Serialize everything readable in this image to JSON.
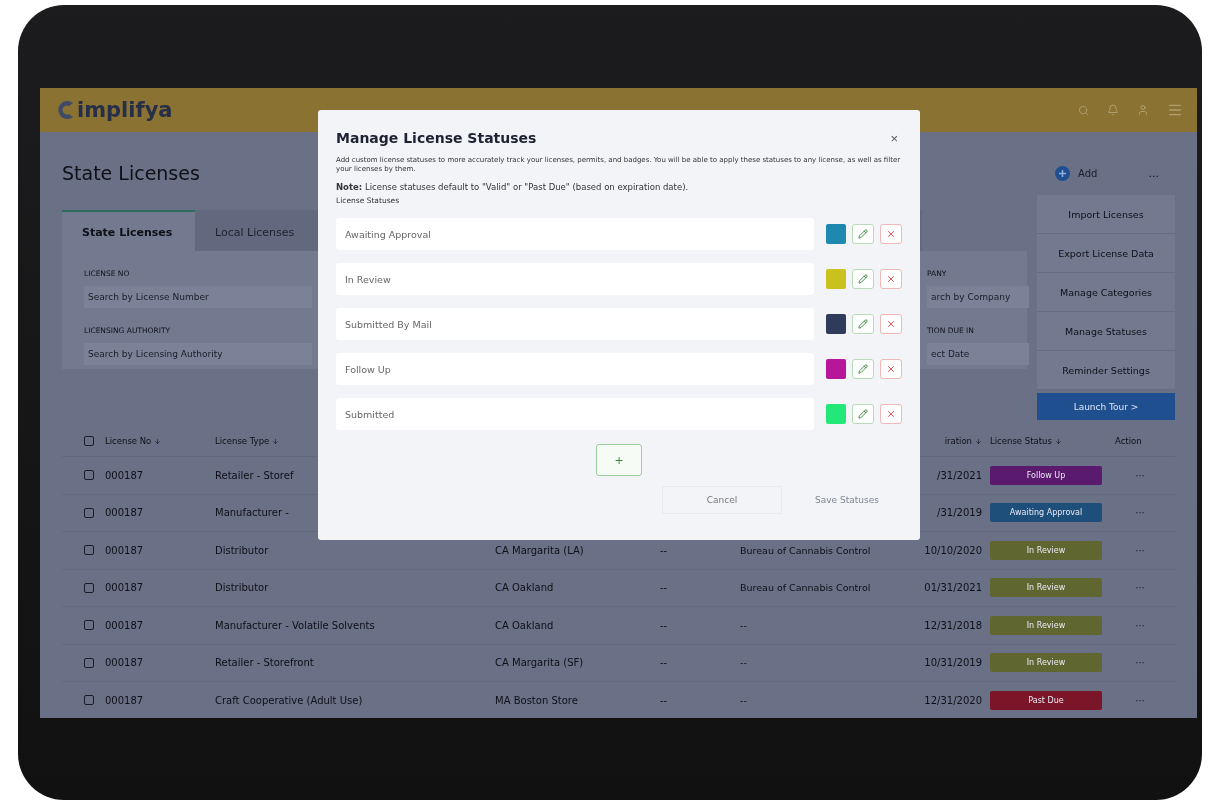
{
  "header": {
    "logo": "implifya"
  },
  "page": {
    "title": "State Licenses"
  },
  "tabs": [
    {
      "label": "State Licenses",
      "selected": true
    },
    {
      "label": "Local Licenses",
      "selected": false
    }
  ],
  "filters": [
    {
      "label": "LICENSE NO",
      "placeholder": "Search by License Number"
    },
    {
      "label": "LICENSING AUTHORITY",
      "placeholder": "Search by Licensing Authority"
    }
  ],
  "filters_right": [
    {
      "label": "PANY",
      "placeholder": "arch by Company"
    },
    {
      "label": "TION DUE IN",
      "placeholder": "ect Date"
    }
  ],
  "actions": {
    "add": "Add",
    "more": "...",
    "menu": [
      "Import Licenses",
      "Export License Data",
      "Manage Categories",
      "Manage Statuses",
      "Reminder Settings"
    ],
    "tour": "Launch Tour >"
  },
  "table": {
    "header_checked": false,
    "columns": [
      "License No",
      "License Type",
      "",
      "",
      "",
      "iration",
      "License Status",
      "Action"
    ],
    "rows": [
      {
        "checked": false,
        "number": "000187",
        "type": "Retailer - Storef",
        "location": "",
        "dash": "",
        "authority": "",
        "date": "/31/2021",
        "status": "Follow Up",
        "color": "#5a1a6e",
        "action": "···"
      },
      {
        "checked": false,
        "number": "000187",
        "type": "Manufacturer -",
        "location": "",
        "dash": "",
        "authority": "",
        "date": "/31/2019",
        "status": "Awaiting Approval",
        "color": "#1e4f7a",
        "action": "···"
      },
      {
        "checked": false,
        "number": "000187",
        "type": "Distributor",
        "location": "CA Margarita (LA)",
        "dash": "--",
        "authority": "Bureau of Cannabis Control",
        "date": "10/10/2020",
        "status": "In Review",
        "color": "#5f6630",
        "action": "···"
      },
      {
        "checked": false,
        "number": "000187",
        "type": "Distributor",
        "location": "CA Oakland",
        "dash": "--",
        "authority": "Bureau of Cannabis Control",
        "date": "01/31/2021",
        "status": "In Review",
        "color": "#5f6630",
        "action": "···"
      },
      {
        "checked": false,
        "number": "000187",
        "type": "Manufacturer - Volatile Solvents",
        "location": "CA Oakland",
        "dash": "--",
        "authority": "--",
        "date": "12/31/2018",
        "status": "In Review",
        "color": "#5f6630",
        "action": "···"
      },
      {
        "checked": false,
        "number": "000187",
        "type": "Retailer - Storefront",
        "location": "CA Margarita (SF)",
        "dash": "--",
        "authority": "--",
        "date": "10/31/2019",
        "status": "In Review",
        "color": "#5f6630",
        "action": "···"
      },
      {
        "checked": false,
        "number": "000187",
        "type": "Craft Cooperative (Adult Use)",
        "location": "MA Boston Store",
        "dash": "--",
        "authority": "--",
        "date": "12/31/2020",
        "status": "Past Due",
        "color": "#7a1628",
        "action": "···"
      }
    ]
  },
  "modal": {
    "title": "Manage License Statuses",
    "close": "×",
    "description": "Add custom license statuses to more accurately track your licenses, permits, and badges. You will be able to apply these statuses to any license, as well as filter your licenses by them.",
    "note": "**Note:** License statuses default to \"Valid\" or \"Past Due\" (based on expiration date).",
    "list_label": "License Statuses",
    "statuses": [
      {
        "name": "Awaiting Approval",
        "color": "#1e88b0"
      },
      {
        "name": "In Review",
        "color": "#c9c21e"
      },
      {
        "name": "Submitted By Mail",
        "color": "#2f3b5a"
      },
      {
        "name": "Follow Up",
        "color": "#b8169a"
      },
      {
        "name": "Submitted",
        "color": "#22e87a"
      }
    ],
    "add": "+",
    "cancel": "Cancel",
    "save": {
      "label": "Save Statuses",
      "disabled": true
    }
  }
}
